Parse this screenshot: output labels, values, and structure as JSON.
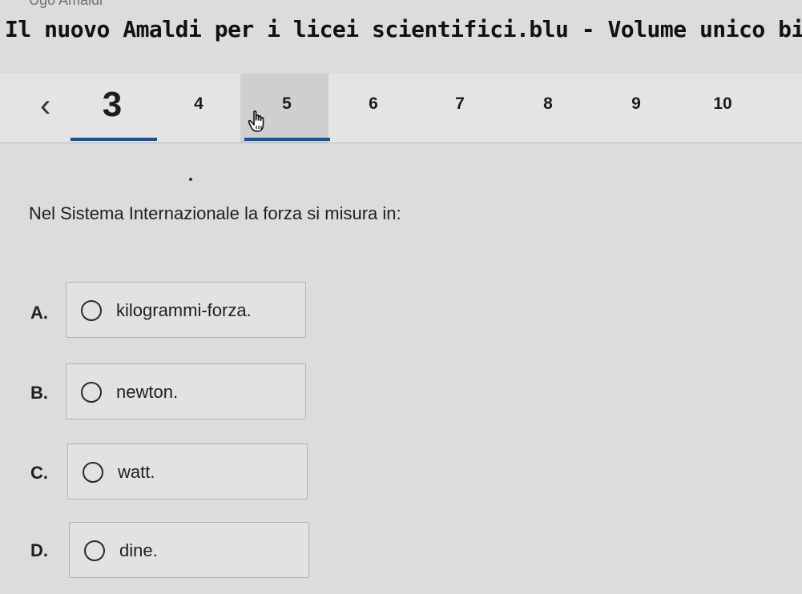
{
  "header": {
    "author": "Ugo Amaldi",
    "book_title": "Il nuovo Amaldi per i licei scientifici.blu - Volume unico bienni"
  },
  "pagination": {
    "prev_icon": "chevron-left-icon",
    "current": "3",
    "pages": [
      "4",
      "5",
      "6",
      "7",
      "8",
      "9",
      "10"
    ],
    "cursor_icon": "hand-pointer-icon"
  },
  "question": {
    "text": "Nel Sistema Internazionale la forza si misura in:"
  },
  "answers": [
    {
      "letter": "A.",
      "text": "kilogrammi-forza."
    },
    {
      "letter": "B.",
      "text": "newton."
    },
    {
      "letter": "C.",
      "text": "watt."
    },
    {
      "letter": "D.",
      "text": "dine."
    }
  ],
  "colors": {
    "accent": "#1f4f8f"
  }
}
